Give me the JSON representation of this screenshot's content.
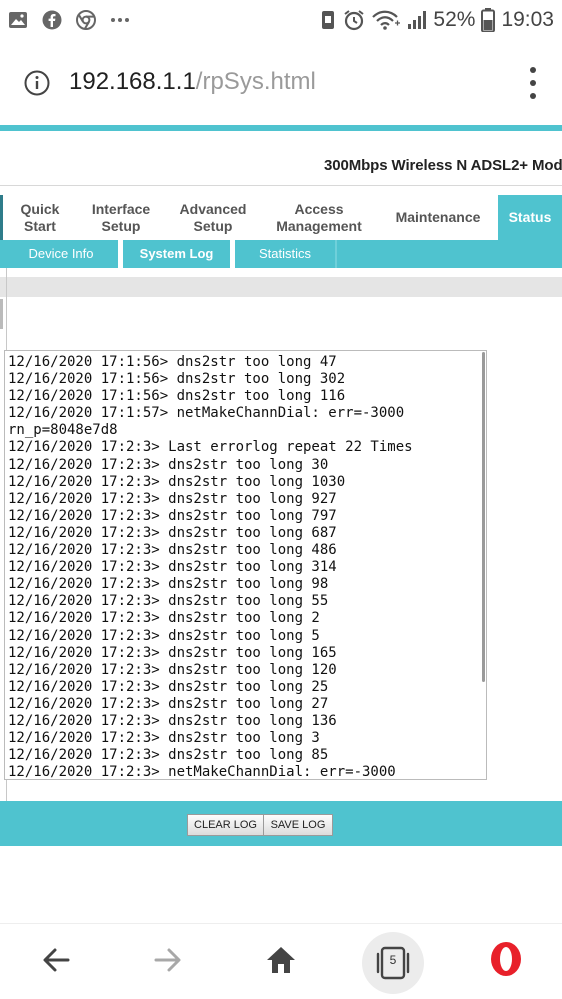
{
  "status_bar": {
    "battery_percent": "52%",
    "time": "19:03",
    "left_icons": [
      "image-icon",
      "facebook-icon",
      "chrome-icon",
      "more-dots-icon"
    ],
    "right_icons": [
      "vibrate-icon",
      "alarm-icon",
      "wifi-icon",
      "signal-icon",
      "battery-icon"
    ]
  },
  "browser": {
    "url_host": "192.168.1.1",
    "url_path": "/rpSys.html",
    "tab_count": "5"
  },
  "router": {
    "product_name": "300Mbps Wireless N ADSL2+ Mod",
    "tabs": [
      {
        "line1": "Quick",
        "line2": "Start"
      },
      {
        "line1": "Interface",
        "line2": "Setup"
      },
      {
        "line1": "Advanced",
        "line2": "Setup"
      },
      {
        "line1": "Access",
        "line2": "Management"
      },
      {
        "line1": "Maintenance",
        "line2": ""
      },
      {
        "line1": "Status",
        "line2": ""
      }
    ],
    "active_tab": "Status",
    "subtabs": [
      "Device Info",
      "System Log",
      "Statistics"
    ],
    "active_subtab": "System Log",
    "log_lines": [
      "12/16/2020 17:1:56> dns2str too long 47",
      "12/16/2020 17:1:56> dns2str too long 302",
      "12/16/2020 17:1:56> dns2str too long 116",
      "12/16/2020 17:1:57> netMakeChannDial: err=-3000",
      "rn_p=8048e7d8",
      "12/16/2020 17:2:3> Last errorlog repeat 22 Times",
      "12/16/2020 17:2:3> dns2str too long 30",
      "12/16/2020 17:2:3> dns2str too long 1030",
      "12/16/2020 17:2:3> dns2str too long 927",
      "12/16/2020 17:2:3> dns2str too long 797",
      "12/16/2020 17:2:3> dns2str too long 687",
      "12/16/2020 17:2:3> dns2str too long 486",
      "12/16/2020 17:2:3> dns2str too long 314",
      "12/16/2020 17:2:3> dns2str too long 98",
      "12/16/2020 17:2:3> dns2str too long 55",
      "12/16/2020 17:2:3> dns2str too long 2",
      "12/16/2020 17:2:3> dns2str too long 5",
      "12/16/2020 17:2:3> dns2str too long 165",
      "12/16/2020 17:2:3> dns2str too long 120",
      "12/16/2020 17:2:3> dns2str too long 25",
      "12/16/2020 17:2:3> dns2str too long 27",
      "12/16/2020 17:2:3> dns2str too long 136",
      "12/16/2020 17:2:3> dns2str too long 3",
      "12/16/2020 17:2:3> dns2str too long 85",
      "12/16/2020 17:2:3> netMakeChannDial: err=-3000"
    ],
    "buttons": {
      "clear_log": "CLEAR LOG",
      "save_log": "SAVE LOG"
    }
  },
  "colors": {
    "accent": "#4fc3cf",
    "accent_dark": "#2f7c8a",
    "opera_red": "#e8202a"
  },
  "nav_icons": [
    "back-arrow-icon",
    "forward-arrow-icon",
    "home-icon",
    "tabs-icon",
    "opera-icon"
  ]
}
